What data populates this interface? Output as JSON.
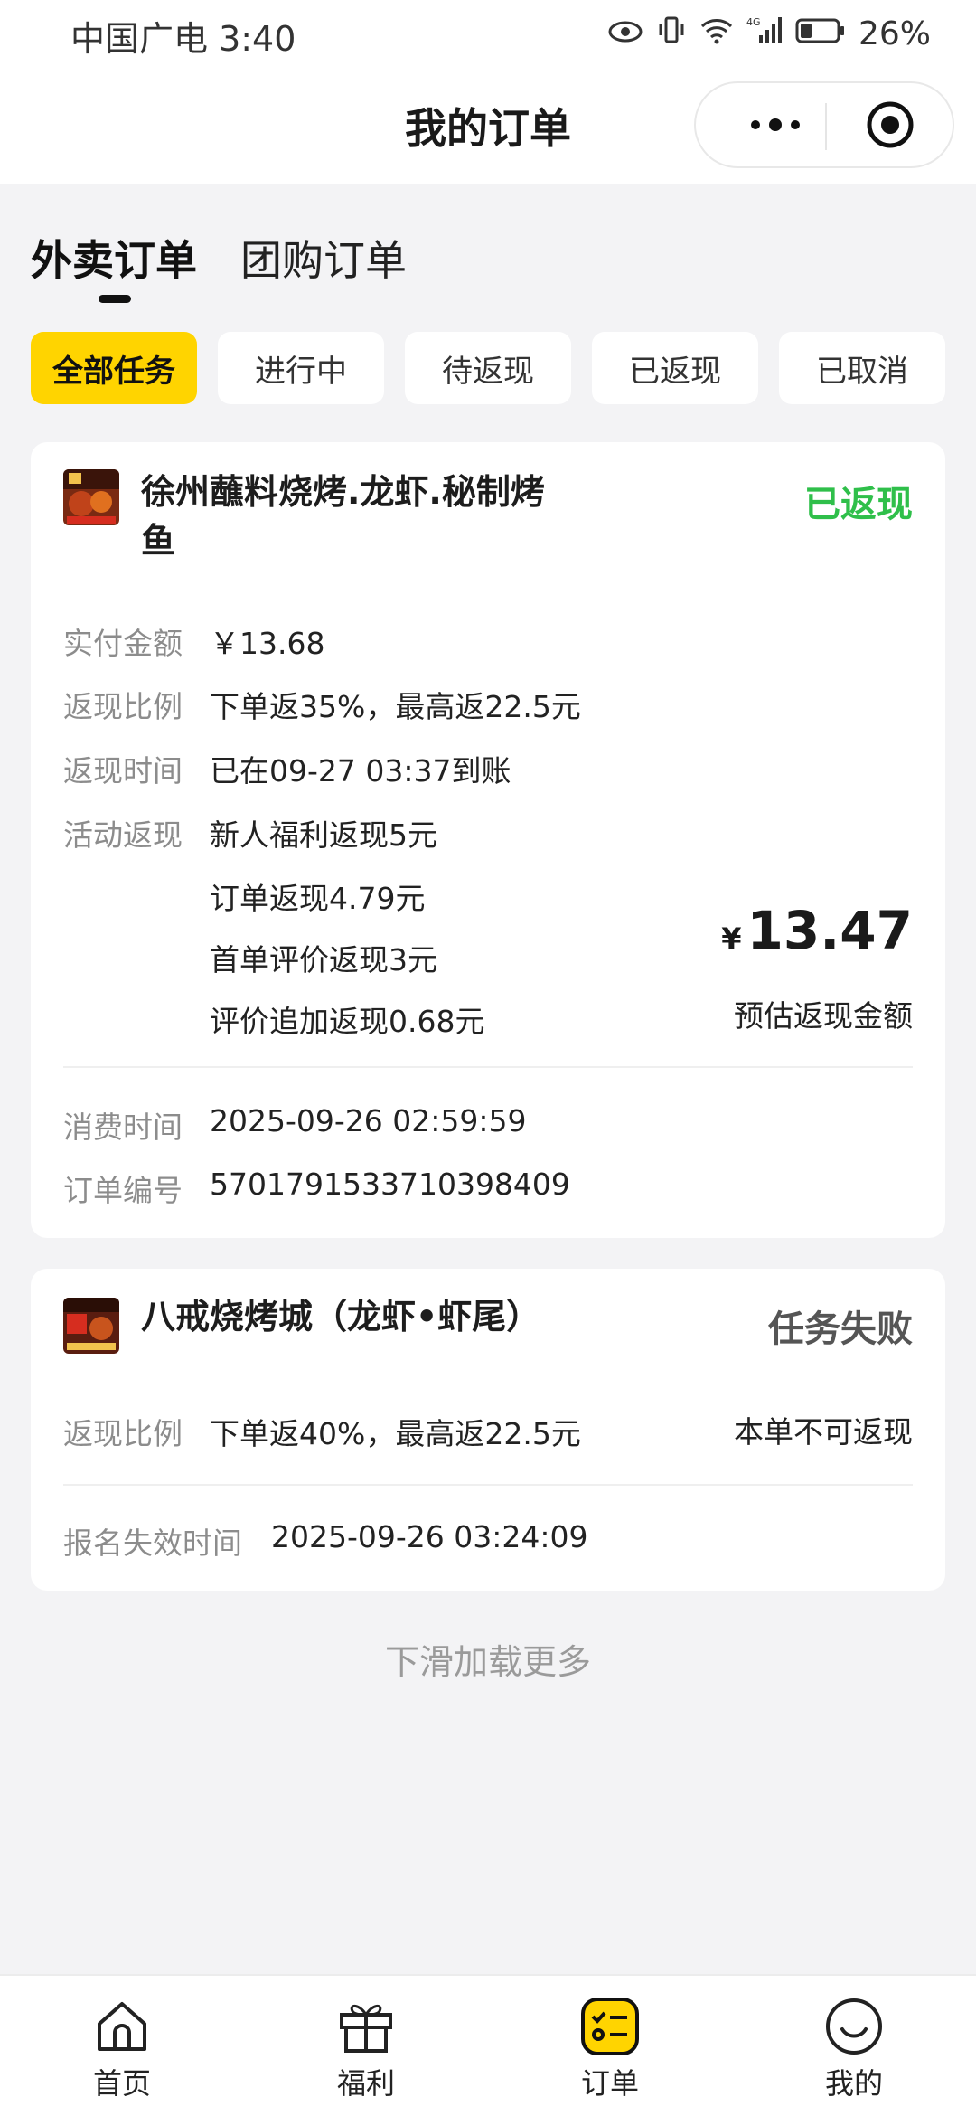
{
  "status_bar": {
    "carrier": "中国广电 3:40",
    "network": "4G",
    "battery": "26%"
  },
  "header": {
    "title": "我的订单"
  },
  "main_tabs": [
    {
      "label": "外卖订单",
      "active": true
    },
    {
      "label": "团购订单",
      "active": false
    }
  ],
  "filters": [
    {
      "label": "全部任务",
      "active": true
    },
    {
      "label": "进行中",
      "active": false
    },
    {
      "label": "待返现",
      "active": false
    },
    {
      "label": "已返现",
      "active": false
    },
    {
      "label": "已取消",
      "active": false
    }
  ],
  "orders": [
    {
      "store_name": "徐州蘸料烧烤.龙虾.秘制烤鱼",
      "status": "已返现",
      "status_color": "#2fbf4a",
      "paid_label": "实付金额",
      "paid_value": "￥13.68",
      "ratio_label": "返现比例",
      "ratio_value": "下单返35%，最高返22.5元",
      "time_label": "返现时间",
      "time_value": "已在09-27 03:37到账",
      "activity_label": "活动返现",
      "activity_items": [
        "新人福利返现5元",
        "订单返现4.79元",
        "首单评价返现3元",
        "评价追加返现0.68元"
      ],
      "currency": "¥",
      "estimated_amount": "13.47",
      "estimated_label": "预估返现金额",
      "consume_label": "消费时间",
      "consume_value": "2025-09-26 02:59:59",
      "order_no_label": "订单编号",
      "order_no_value": "5701791533710398409"
    },
    {
      "store_name": "八戒烧烤城（龙虾•虾尾）",
      "status": "任务失败",
      "status_color": "#555555",
      "ratio_label": "返现比例",
      "ratio_value": "下单返40%，最高返22.5元",
      "note": "本单不可返现",
      "expire_label": "报名失效时间",
      "expire_value": "2025-09-26 03:24:09"
    }
  ],
  "load_more": "下滑加载更多",
  "bottom_nav": [
    {
      "label": "首页",
      "icon": "home-icon"
    },
    {
      "label": "福利",
      "icon": "gift-icon"
    },
    {
      "label": "订单",
      "icon": "order-list-icon",
      "active": true
    },
    {
      "label": "我的",
      "icon": "smile-face-icon"
    }
  ],
  "colors": {
    "accent": "#ffd400",
    "success": "#2fbf4a",
    "background": "#f3f3f5"
  }
}
